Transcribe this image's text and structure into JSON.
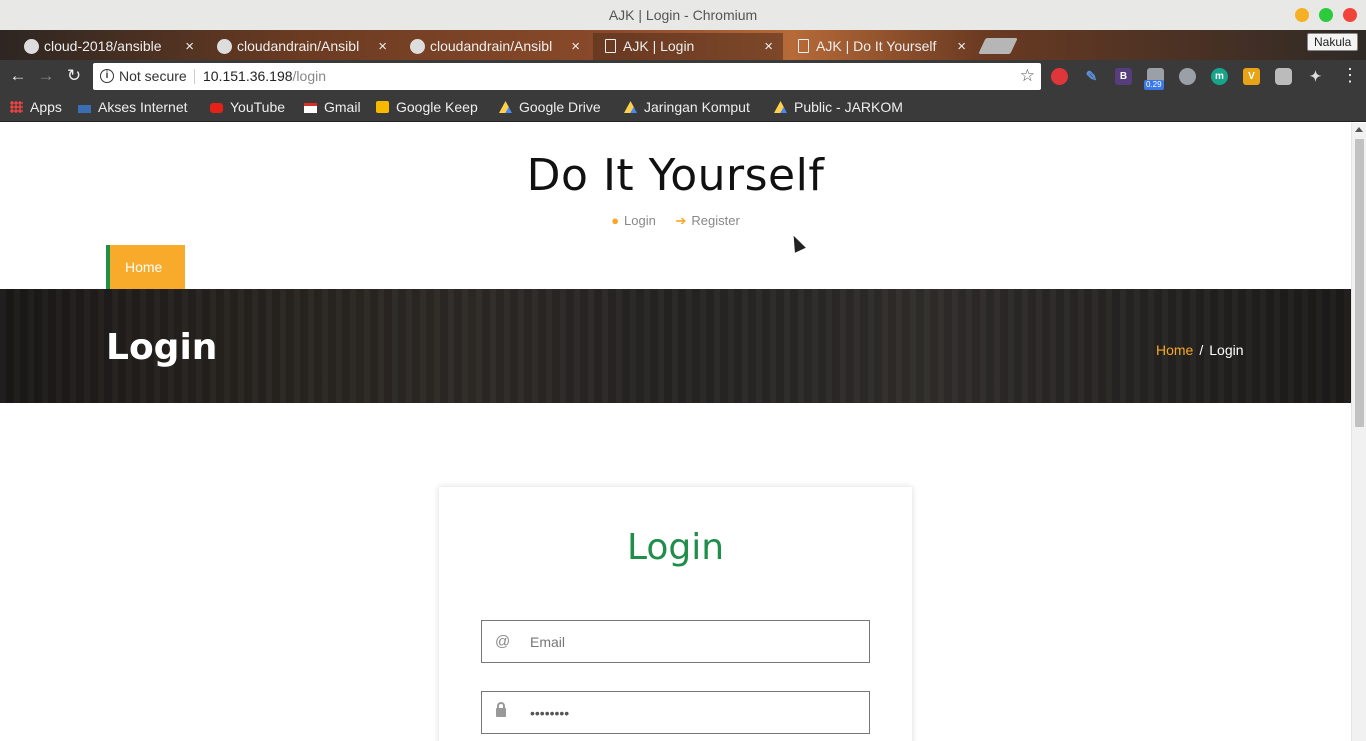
{
  "window": {
    "title": "AJK | Login - Chromium"
  },
  "tabs": [
    {
      "label": "cloud-2018/ansible",
      "icon": "github-icon"
    },
    {
      "label": "cloudandrain/Ansibl",
      "icon": "github-icon"
    },
    {
      "label": "cloudandrain/Ansibl",
      "icon": "github-icon"
    },
    {
      "label": "AJK | Login",
      "icon": "document-icon",
      "active": true
    },
    {
      "label": "AJK | Do It Yourself",
      "icon": "document-icon"
    }
  ],
  "profile": {
    "name": "Nakula"
  },
  "omnibox": {
    "security": "Not secure",
    "host": "10.151.36.198",
    "path": "/login"
  },
  "extensions": [
    {
      "icon": "stop-hand-icon",
      "color": "#e0353a",
      "text": ""
    },
    {
      "icon": "pen-icon",
      "color": "#5b8fd9",
      "text": ""
    },
    {
      "icon": "bootstrap-icon",
      "color": "#563d7c",
      "text": "B"
    },
    {
      "icon": "robot-icon",
      "color": "#9aa0a6",
      "text": ""
    },
    {
      "icon": "cloud-icon",
      "color": "#9aa0a6",
      "text": ""
    },
    {
      "icon": "m-icon",
      "color": "#17a589",
      "text": "m"
    },
    {
      "icon": "v-icon",
      "color": "#e8a317",
      "text": "V"
    },
    {
      "icon": "chat-icon",
      "color": "#bbbbbb",
      "text": ""
    },
    {
      "icon": "tools-icon",
      "color": "#dddddd",
      "text": ""
    }
  ],
  "extension_badge": "0.29",
  "bookmarks": [
    {
      "label": "Apps",
      "icon": "apps-grid-icon"
    },
    {
      "label": "Akses Internet",
      "icon": "its-icon"
    },
    {
      "label": "YouTube",
      "icon": "youtube-icon"
    },
    {
      "label": "Gmail",
      "icon": "gmail-icon"
    },
    {
      "label": "Google Keep",
      "icon": "keep-icon"
    },
    {
      "label": "Google Drive",
      "icon": "drive-icon"
    },
    {
      "label": "Jaringan Komput",
      "icon": "drive-icon"
    },
    {
      "label": "Public - JARKOM",
      "icon": "drive-icon"
    }
  ],
  "site": {
    "title": "Do It Yourself",
    "login_link": "Login",
    "register_link": "Register",
    "nav_home": "Home"
  },
  "banner": {
    "heading": "Login",
    "breadcrumb_home": "Home",
    "breadcrumb_sep": "/",
    "breadcrumb_current": "Login"
  },
  "login_card": {
    "title": "Login",
    "email_icon": "@",
    "email_placeholder": "Email",
    "password_value": "••••••••"
  },
  "colors": {
    "accent_orange": "#f8ab2a",
    "accent_green": "#1e8e4a"
  }
}
